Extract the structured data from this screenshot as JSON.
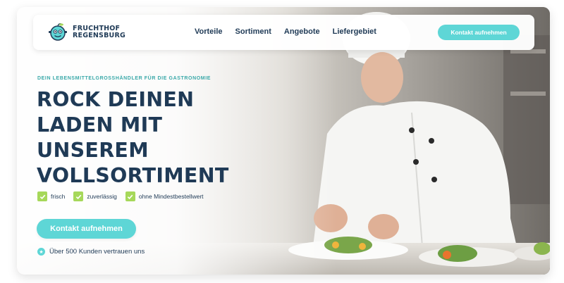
{
  "brand": {
    "line1": "FRUCHTHOF",
    "line2": "REGENSBURG",
    "logo_icon": "fruit-mascot-icon"
  },
  "nav": {
    "items": [
      "Vorteile",
      "Sortiment",
      "Angebote",
      "Liefergebiet"
    ],
    "cta_label": "Kontakt aufnehmen"
  },
  "hero": {
    "eyebrow": "DEIN LEBENSMITTELGROSSHÄNDLER FÜR DIE GASTRONOMIE",
    "headline": [
      "ROCK DEINEN",
      "LADEN MIT",
      "UNSEREM",
      "VOLLSORTIMENT"
    ],
    "features": [
      "frisch",
      "zuverlässig",
      "ohne Mindestbestellwert"
    ],
    "cta_label": "Kontakt aufnehmen",
    "trust_text": "Über 500 Kunden vertrauen uns"
  },
  "colors": {
    "accent": "#5ed6d6",
    "primary": "#1f3a56",
    "check": "#a6d85a",
    "eyebrow": "#3aa9a9"
  }
}
